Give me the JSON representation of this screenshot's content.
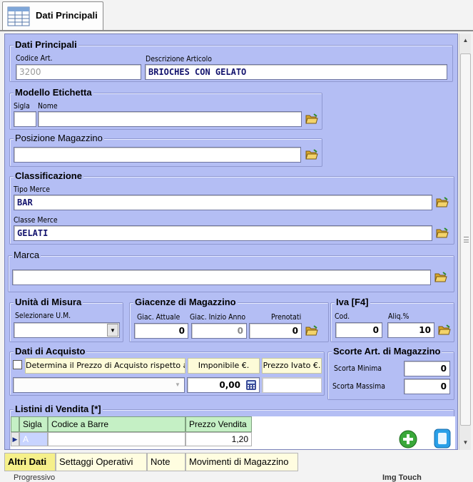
{
  "window": {
    "tab_label": "Dati Principali"
  },
  "dati_principali": {
    "title": "Dati Principali",
    "codice_label": "Codice Art.",
    "codice_value": "3200",
    "descrizione_label": "Descrizione Articolo",
    "descrizione_value": "BRIOCHES CON GELATO"
  },
  "modello_etichetta": {
    "title": "Modello Etichetta",
    "sigla_label": "Sigla",
    "nome_label": "Nome",
    "sigla_value": "",
    "nome_value": ""
  },
  "posizione_magazzino": {
    "title": "Posizione Magazzino",
    "value": ""
  },
  "classificazione": {
    "title": "Classificazione",
    "tipo_label": "Tipo Merce",
    "tipo_value": "BAR",
    "classe_label": "Classe Merce",
    "classe_value": "GELATI"
  },
  "marca": {
    "title": "Marca",
    "value": ""
  },
  "unita_misura": {
    "title": "Unità di Misura",
    "select_label": "Selezionare U.M.",
    "selected": ""
  },
  "giacenze": {
    "title": "Giacenze di Magazzino",
    "attuale_label": "Giac. Attuale",
    "attuale_value": "0",
    "inizio_label": "Giac. Inizio Anno",
    "inizio_value": "0",
    "prenotati_label": "Prenotati",
    "prenotati_value": "0"
  },
  "iva": {
    "title": "Iva [F4]",
    "cod_label": "Cod.",
    "cod_value": "0",
    "aliq_label": "Aliq.%",
    "aliq_value": "10"
  },
  "dati_acquisto": {
    "title": "Dati di Acquisto",
    "determina_label": "Determina il Prezzo di Acquisto rispetto al",
    "imponibile_label": "Imponibile €.",
    "ivato_label": "Prezzo Ivato €.",
    "imponibile_value": "0,00",
    "ivato_value": "",
    "combo_value": ""
  },
  "scorte": {
    "title": "Scorte Art. di Magazzino",
    "minima_label": "Scorta Minima",
    "minima_value": "0",
    "massima_label": "Scorta Massima",
    "massima_value": "0"
  },
  "listini": {
    "title": "Listini di Vendita [*]",
    "columns": [
      "Sigla",
      "Codice a Barre",
      "Prezzo Vendita"
    ],
    "rows": [
      {
        "sigla": "A",
        "codice": "",
        "prezzo": "1,20"
      }
    ]
  },
  "bottom_tabs": [
    "Altri Dati",
    "Settaggi Operativi",
    "Note",
    "Movimenti di Magazzino"
  ],
  "cut_off": {
    "left": "Progressivo",
    "right": "Img Touch"
  },
  "colors": {
    "panel": "#b4bef4",
    "grid_header": "#c5f0c5",
    "active_tab": "#f6f08a",
    "field_text": "#14146e"
  }
}
